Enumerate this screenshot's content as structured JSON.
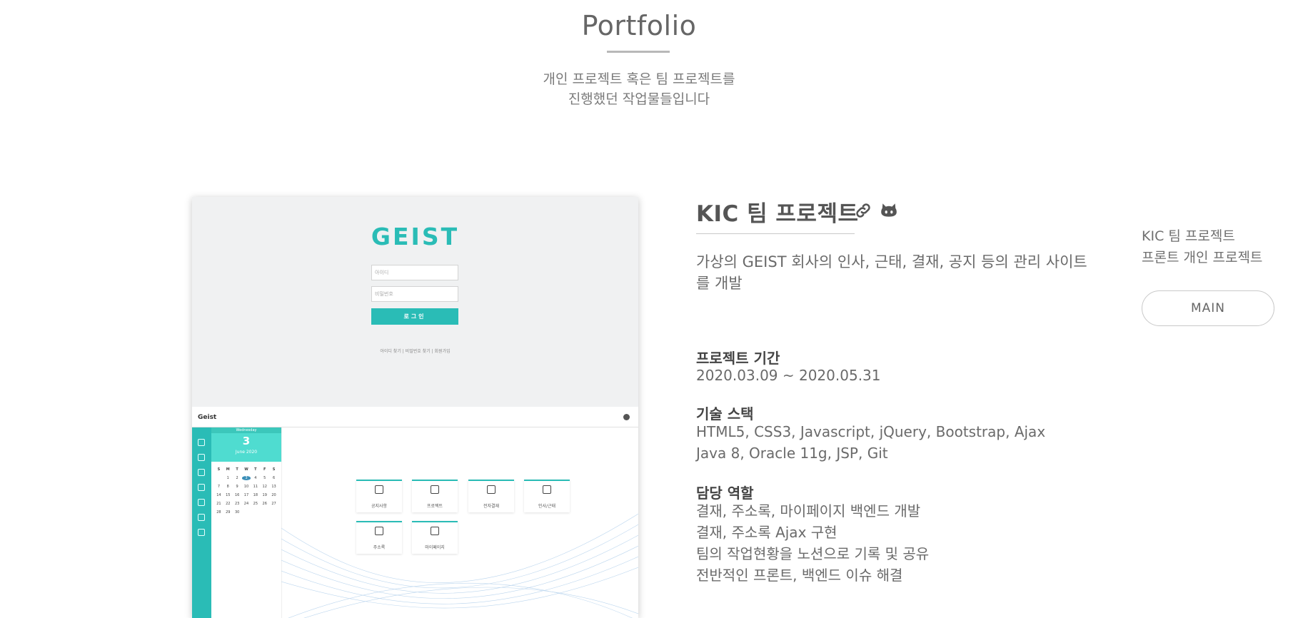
{
  "section": {
    "title": "Portfolio",
    "subtitle_line1": "개인 프로젝트 혹은 팀 프로젝트를",
    "subtitle_line2": "진행했던 작업물들입니다"
  },
  "screenshot": {
    "logo": "GEIST",
    "id_placeholder": "아이디",
    "pw_placeholder": "비밀번호",
    "login_label": "로그인",
    "login_links": "아이디 찾기 | 비밀번호 찾기 | 회원가입",
    "dash_logo": "Geist",
    "calendar": {
      "weekday": "Wednesday",
      "date": "3",
      "month": "June 2020",
      "day_heads": [
        "S",
        "M",
        "T",
        "W",
        "T",
        "F",
        "S"
      ],
      "days": [
        "",
        "1",
        "2",
        "3",
        "4",
        "5",
        "6",
        "7",
        "8",
        "9",
        "10",
        "11",
        "12",
        "13",
        "14",
        "15",
        "16",
        "17",
        "18",
        "19",
        "20",
        "21",
        "22",
        "23",
        "24",
        "25",
        "26",
        "27",
        "28",
        "29",
        "30"
      ],
      "today": "3"
    },
    "tiles": [
      "공지사항",
      "프로젝트",
      "전자결재",
      "인사/근태",
      "주소록",
      "마이페이지"
    ]
  },
  "project": {
    "title": "KIC 팀 프로젝트",
    "link_icon": "link-icon",
    "github_icon": "github-icon",
    "description": "가상의 GEIST 회사의 인사, 근태, 결재, 공지 등의 관리 사이트를 개발",
    "period_heading": "프로젝트 기간",
    "period": "2020.03.09 ~ 2020.05.31",
    "stack_heading": "기술 스택",
    "stack_line1": "HTML5, CSS3, Javascript, jQuery, Bootstrap, Ajax",
    "stack_line2": "Java 8, Oracle 11g, JSP, Git",
    "role_heading": "담당 역할",
    "roles": [
      "결재, 주소록, 마이페이지 백엔드 개발",
      "결재, 주소록 Ajax 구현",
      "팀의 작업현황을 노션으로 기록 및 공유",
      "전반적인 프론트, 백엔드 이슈 해결"
    ]
  },
  "side_nav": {
    "items": [
      "KIC 팀 프로젝트",
      "프론트 개인 프로젝트"
    ],
    "main_button": "MAIN"
  }
}
